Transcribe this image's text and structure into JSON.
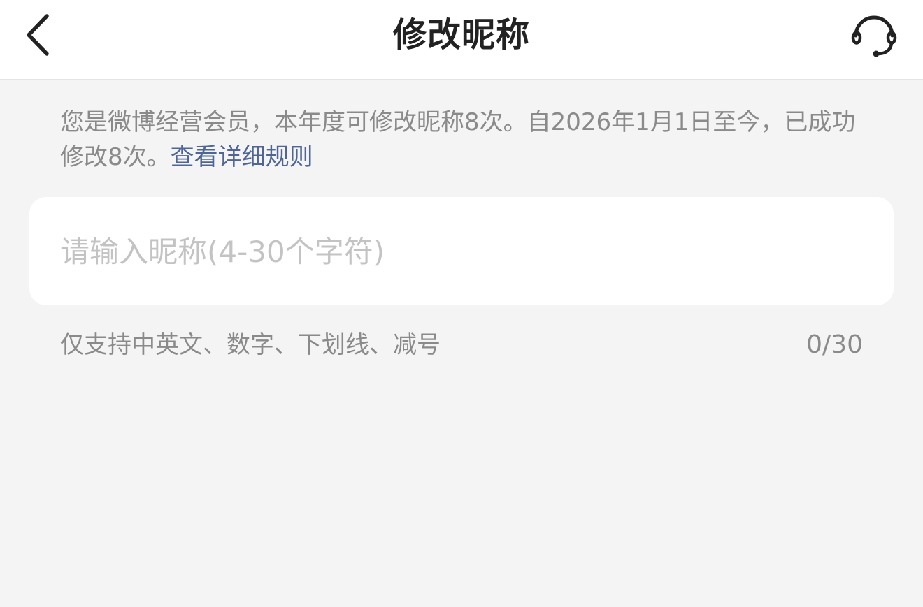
{
  "header": {
    "title": "修改昵称",
    "back_icon": "chevron-left-icon",
    "service_icon": "headset-icon"
  },
  "notice": {
    "text": "您是微博经营会员，本年度可修改昵称8次。自2026年1月1日至今，已成功修改8次。",
    "link_label": "查看详细规则",
    "link_color": "#4e6596"
  },
  "nickname": {
    "value": "",
    "placeholder": "请输入昵称(4-30个字符)"
  },
  "hint": "仅支持中英文、数字、下划线、减号",
  "counter": "0/30",
  "colors": {
    "page_background": "#f4f4f4",
    "card_background": "#ffffff",
    "secondary_text": "#8a8a8a",
    "placeholder_text": "#c3c3c3"
  }
}
